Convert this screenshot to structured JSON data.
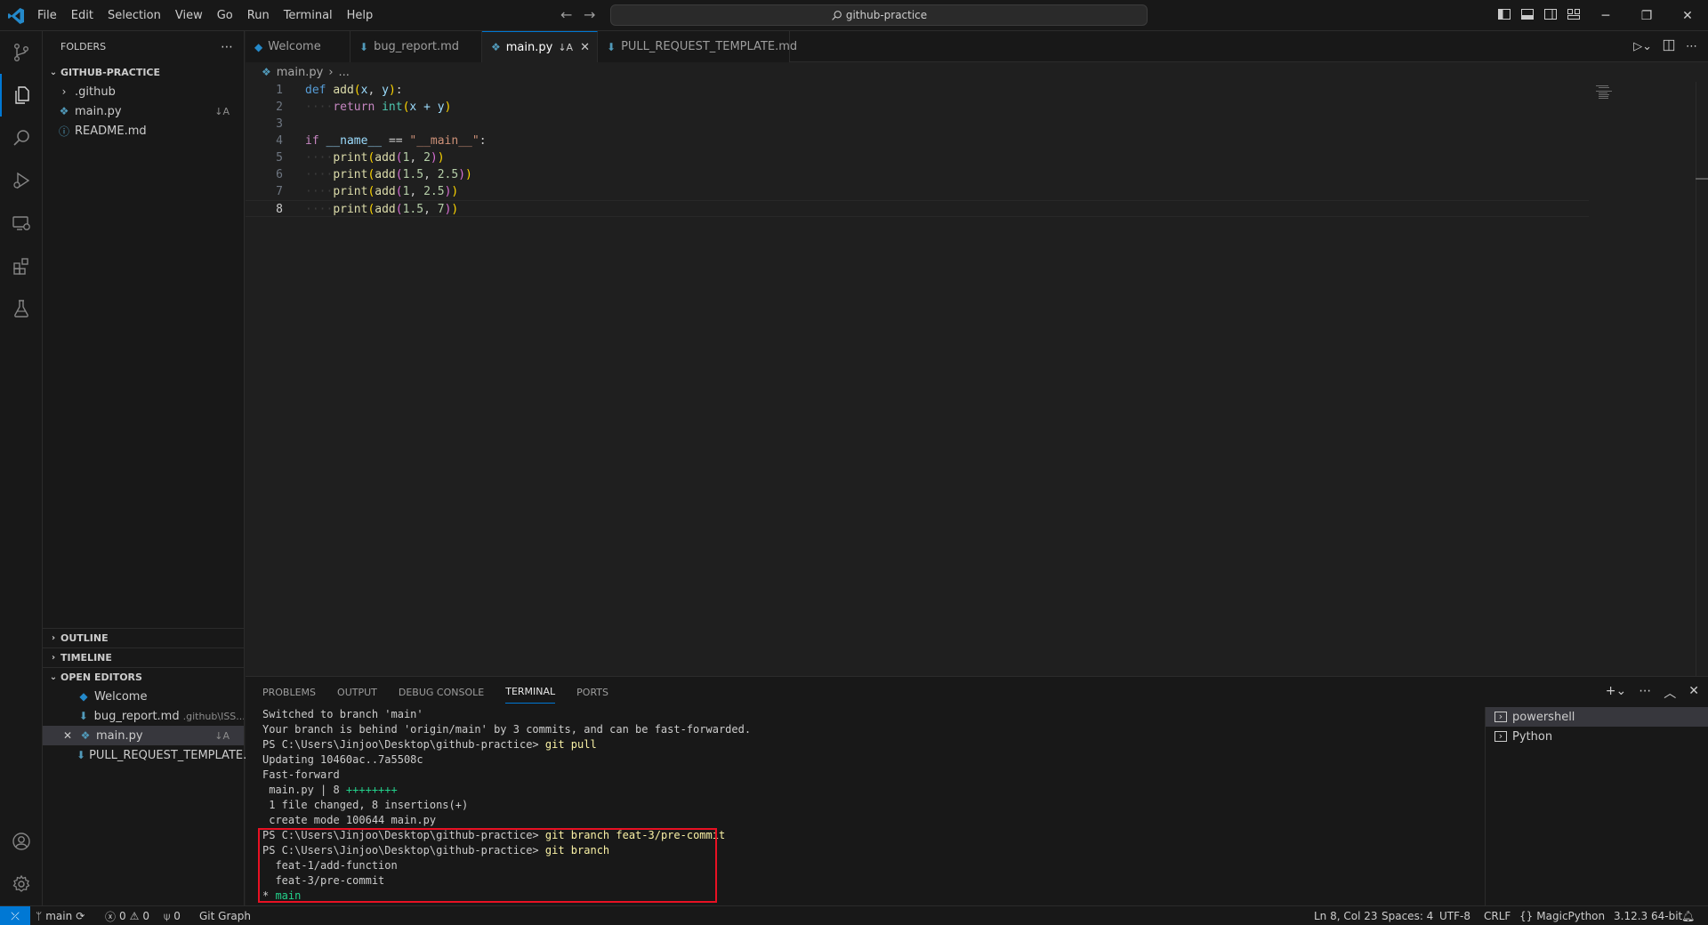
{
  "menu": [
    "File",
    "Edit",
    "Selection",
    "View",
    "Go",
    "Run",
    "Terminal",
    "Help"
  ],
  "command_center": "github-practice",
  "sidebar": {
    "title": "FOLDERS",
    "root": "GITHUB-PRACTICE",
    "files": [
      {
        "name": ".github",
        "type": "folder"
      },
      {
        "name": "main.py",
        "badge": "↓A"
      },
      {
        "name": "README.md"
      }
    ],
    "outline": "OUTLINE",
    "timeline": "TIMELINE",
    "open_editors": "OPEN EDITORS",
    "open_files": [
      {
        "name": "Welcome"
      },
      {
        "name": "bug_report.md",
        "desc": ".github\\ISS..."
      },
      {
        "name": "main.py",
        "badge": "↓A"
      },
      {
        "name": "PULL_REQUEST_TEMPLATE..."
      }
    ]
  },
  "tabs": [
    {
      "label": "Welcome"
    },
    {
      "label": "bug_report.md"
    },
    {
      "label": "main.py",
      "badge": "↓A"
    },
    {
      "label": "PULL_REQUEST_TEMPLATE.md"
    }
  ],
  "breadcrumb": {
    "file": "main.py",
    "rest": "..."
  },
  "code": {
    "line_numbers": [
      "1",
      "2",
      "3",
      "4",
      "5",
      "6",
      "7",
      "8"
    ],
    "l1": {
      "kw": "def",
      "fn": "add",
      "args": "(x, y):"
    },
    "l2": {
      "kw": "return",
      "fn": "int",
      "expr": "x + y"
    },
    "l4": {
      "kw": "if",
      "name": "__name__",
      "op": "==",
      "str": "\"__main__\"",
      "colon": ":"
    },
    "l5": {
      "a": "1",
      "b": "2"
    },
    "l6": {
      "a": "1.5",
      "b": "2.5"
    },
    "l7": {
      "a": "1",
      "b": "2.5"
    },
    "l8": {
      "a": "1.5",
      "b": "7"
    }
  },
  "panel": {
    "tabs": [
      "PROBLEMS",
      "OUTPUT",
      "DEBUG CONSOLE",
      "TERMINAL",
      "PORTS"
    ],
    "terminal_lines": [
      "Switched to branch 'main'",
      "Your branch is behind 'origin/main' by 3 commits, and can be fast-forwarded.",
      "Updating 10460ac..7a5508c",
      "Fast-forward",
      " main.py | 8 ",
      " 1 file changed, 8 insertions(+)",
      " create mode 100644 main.py",
      "  feat-1/add-function",
      "  feat-3/pre-commit"
    ],
    "prompt": "PS C:\\Users\\Jinjoo\\Desktop\\github-practice>",
    "cmd_pull": "git pull",
    "plus_marks": "++++++++",
    "cmd_branch_create": "git branch feat-3/pre-commit",
    "cmd_branch": "git branch",
    "current_branch_marker": "* ",
    "current_branch": "main",
    "terminals": [
      "powershell",
      "Python"
    ]
  },
  "status": {
    "branch": "main",
    "errors": "0",
    "warnings": "0",
    "ports": "0",
    "git_graph": "Git Graph",
    "position": "Ln 8, Col 23",
    "spaces": "Spaces: 4",
    "encoding": "UTF-8",
    "eol": "CRLF",
    "language": "MagicPython",
    "interpreter": "3.12.3 64-bit"
  },
  "colors": {
    "accent": "#0078d4",
    "highlight_box": "#e81123"
  }
}
